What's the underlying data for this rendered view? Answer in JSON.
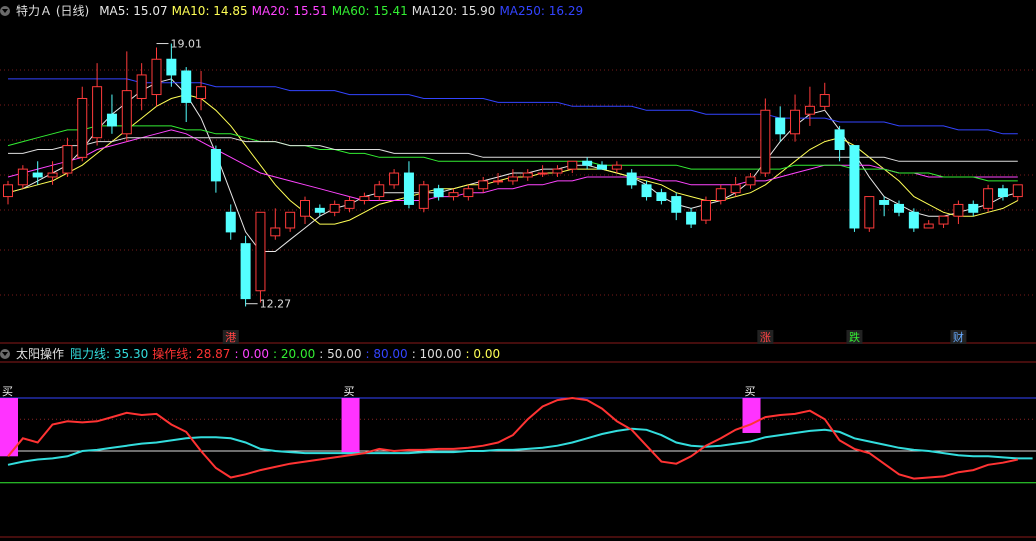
{
  "main_header": {
    "title": "特力Ａ (日线)",
    "ma": [
      {
        "label": "MA5: 15.07",
        "color": "#e8e8e8"
      },
      {
        "label": "MA10: 14.85",
        "color": "#ffff55"
      },
      {
        "label": "MA20: 15.51",
        "color": "#ff44ff"
      },
      {
        "label": "MA60: 15.41",
        "color": "#33ee33"
      },
      {
        "label": "MA120: 15.90",
        "color": "#dddddd"
      },
      {
        "label": "MA250: 16.29",
        "color": "#3344ff"
      }
    ]
  },
  "sub_header": {
    "title": "太阳操作",
    "items": [
      {
        "label": "阻力线: 35.30",
        "color": "#33dddd"
      },
      {
        "label": "操作线: 28.87",
        "color": "#ff3333"
      },
      {
        "label": ": 0.00",
        "color": "#ff44ff"
      },
      {
        "label": ": 20.00",
        "color": "#33ee33"
      },
      {
        "label": ": 50.00",
        "color": "#dddddd"
      },
      {
        "label": ": 80.00",
        "color": "#3344ff"
      },
      {
        "label": ": 100.00",
        "color": "#dddddd"
      },
      {
        "label": ": 0.00",
        "color": "#ffff55"
      }
    ]
  },
  "chart_data": [
    {
      "type": "candlestick",
      "title": "特力Ａ (日线)",
      "ylim": [
        11.6,
        19.5
      ],
      "price_labels": {
        "high": "19.01",
        "low": "12.27"
      },
      "event_markers": [
        {
          "label": "港",
          "index": 15,
          "color": "#ff4444"
        },
        {
          "label": "涨",
          "index": 51,
          "color": "#ff4444"
        },
        {
          "label": "跌",
          "index": 57,
          "color": "#33ee33"
        },
        {
          "label": "财",
          "index": 64,
          "color": "#66aaff"
        }
      ],
      "candles": [
        [
          15.0,
          15.3,
          14.8,
          15.4
        ],
        [
          15.3,
          15.7,
          15.2,
          15.8
        ],
        [
          15.6,
          15.5,
          15.3,
          15.9
        ],
        [
          15.5,
          15.6,
          15.3,
          15.9
        ],
        [
          15.6,
          16.3,
          15.5,
          16.5
        ],
        [
          16.0,
          17.5,
          15.9,
          17.8
        ],
        [
          16.5,
          17.8,
          16.3,
          18.4
        ],
        [
          17.1,
          16.8,
          16.6,
          17.6
        ],
        [
          16.6,
          17.7,
          16.4,
          18.7
        ],
        [
          17.5,
          18.1,
          17.2,
          18.4
        ],
        [
          17.6,
          18.5,
          17.3,
          18.8
        ],
        [
          18.5,
          18.1,
          17.8,
          18.9
        ],
        [
          18.2,
          17.4,
          16.9,
          18.3
        ],
        [
          17.5,
          17.8,
          17.2,
          18.2
        ],
        [
          16.2,
          15.4,
          15.1,
          16.3
        ],
        [
          14.6,
          14.1,
          13.9,
          14.8
        ],
        [
          13.8,
          12.4,
          12.2,
          14.0
        ],
        [
          12.6,
          14.6,
          12.3,
          14.6
        ],
        [
          14.0,
          14.2,
          13.9,
          14.7
        ],
        [
          14.2,
          14.6,
          14.1,
          14.6
        ],
        [
          14.5,
          14.9,
          14.3,
          15.0
        ],
        [
          14.7,
          14.6,
          14.5,
          14.8
        ],
        [
          14.6,
          14.8,
          14.5,
          14.9
        ],
        [
          14.7,
          14.9,
          14.6,
          15.0
        ],
        [
          14.9,
          15.0,
          14.8,
          15.1
        ],
        [
          15.0,
          15.3,
          14.9,
          15.4
        ],
        [
          15.3,
          15.6,
          15.2,
          15.7
        ],
        [
          15.6,
          14.8,
          14.7,
          15.9
        ],
        [
          14.7,
          15.3,
          14.6,
          15.4
        ],
        [
          15.2,
          15.0,
          14.9,
          15.3
        ],
        [
          15.0,
          15.1,
          14.9,
          15.2
        ],
        [
          15.0,
          15.2,
          14.9,
          15.3
        ],
        [
          15.2,
          15.4,
          15.1,
          15.5
        ],
        [
          15.4,
          15.4,
          15.3,
          15.6
        ],
        [
          15.4,
          15.5,
          15.3,
          15.7
        ],
        [
          15.5,
          15.6,
          15.4,
          15.7
        ],
        [
          15.6,
          15.6,
          15.5,
          15.8
        ],
        [
          15.6,
          15.7,
          15.5,
          15.8
        ],
        [
          15.7,
          15.9,
          15.6,
          15.9
        ],
        [
          15.9,
          15.8,
          15.7,
          16.0
        ],
        [
          15.8,
          15.7,
          15.7,
          15.9
        ],
        [
          15.7,
          15.8,
          15.6,
          15.9
        ],
        [
          15.6,
          15.3,
          15.2,
          15.7
        ],
        [
          15.3,
          15.0,
          14.9,
          15.4
        ],
        [
          15.1,
          14.9,
          14.8,
          15.2
        ],
        [
          15.0,
          14.6,
          14.4,
          15.1
        ],
        [
          14.6,
          14.3,
          14.2,
          14.7
        ],
        [
          14.4,
          14.9,
          14.3,
          15.0
        ],
        [
          14.9,
          15.2,
          14.8,
          15.3
        ],
        [
          15.1,
          15.3,
          15.0,
          15.5
        ],
        [
          15.3,
          15.5,
          15.2,
          15.6
        ],
        [
          15.6,
          17.2,
          15.5,
          17.5
        ],
        [
          17.0,
          16.6,
          16.4,
          17.3
        ],
        [
          16.6,
          17.2,
          16.4,
          17.6
        ],
        [
          17.1,
          17.3,
          16.8,
          17.8
        ],
        [
          17.3,
          17.6,
          17.2,
          17.9
        ],
        [
          16.7,
          16.2,
          15.9,
          16.8
        ],
        [
          16.3,
          14.2,
          14.1,
          16.3
        ],
        [
          14.2,
          15.0,
          14.1,
          15.0
        ],
        [
          14.9,
          14.8,
          14.5,
          15.0
        ],
        [
          14.8,
          14.6,
          14.5,
          14.9
        ],
        [
          14.6,
          14.2,
          14.1,
          14.7
        ],
        [
          14.2,
          14.3,
          14.2,
          14.4
        ],
        [
          14.3,
          14.5,
          14.2,
          14.5
        ],
        [
          14.5,
          14.8,
          14.3,
          14.9
        ],
        [
          14.8,
          14.6,
          14.5,
          14.9
        ],
        [
          14.7,
          15.2,
          14.6,
          15.3
        ],
        [
          15.2,
          15.0,
          14.9,
          15.3
        ],
        [
          15.0,
          15.3,
          14.9,
          15.3
        ]
      ],
      "series": [
        {
          "name": "MA5",
          "color": "#e8e8e8",
          "values": [
            15.1,
            15.2,
            15.4,
            15.6,
            15.8,
            16.2,
            16.7,
            17.1,
            17.4,
            17.7,
            17.9,
            18.0,
            17.6,
            17.0,
            16.1,
            15.1,
            14.1,
            13.6,
            13.6,
            13.9,
            14.2,
            14.5,
            14.7,
            14.8,
            15.0,
            15.1,
            15.1,
            15.1,
            15.1,
            15.1,
            15.2,
            15.3,
            15.4,
            15.5,
            15.6,
            15.6,
            15.7,
            15.7,
            15.8,
            15.8,
            15.7,
            15.6,
            15.5,
            15.3,
            15.0,
            14.8,
            14.7,
            14.8,
            14.9,
            15.1,
            15.4,
            15.9,
            16.4,
            16.8,
            17.1,
            17.2,
            16.7,
            16.1,
            15.5,
            15.0,
            14.8,
            14.6,
            14.5,
            14.5,
            14.6,
            14.7,
            14.8,
            15.0,
            15.1
          ]
        },
        {
          "name": "MA10",
          "color": "#ffff55",
          "values": [
            15.1,
            15.2,
            15.3,
            15.4,
            15.6,
            15.8,
            16.1,
            16.4,
            16.7,
            17.0,
            17.3,
            17.5,
            17.6,
            17.5,
            17.2,
            16.8,
            16.3,
            15.8,
            15.3,
            14.9,
            14.6,
            14.3,
            14.3,
            14.4,
            14.6,
            14.8,
            14.9,
            15.0,
            15.1,
            15.2,
            15.2,
            15.3,
            15.3,
            15.4,
            15.5,
            15.5,
            15.6,
            15.6,
            15.7,
            15.7,
            15.7,
            15.6,
            15.5,
            15.4,
            15.3,
            15.1,
            15.0,
            14.9,
            14.9,
            15.0,
            15.1,
            15.3,
            15.6,
            15.9,
            16.2,
            16.4,
            16.5,
            16.3,
            16.0,
            15.7,
            15.4,
            15.0,
            14.8,
            14.6,
            14.5,
            14.5,
            14.6,
            14.7,
            14.9
          ]
        },
        {
          "name": "MA20",
          "color": "#ff44ff",
          "values": [
            15.5,
            15.6,
            15.7,
            15.8,
            15.9,
            16.0,
            16.2,
            16.3,
            16.4,
            16.5,
            16.6,
            16.7,
            16.6,
            16.4,
            16.2,
            16.0,
            15.8,
            15.6,
            15.5,
            15.4,
            15.3,
            15.2,
            15.1,
            15.0,
            14.9,
            14.9,
            14.9,
            14.9,
            14.9,
            15.0,
            15.0,
            15.1,
            15.1,
            15.2,
            15.2,
            15.3,
            15.3,
            15.4,
            15.4,
            15.5,
            15.5,
            15.5,
            15.5,
            15.5,
            15.4,
            15.4,
            15.3,
            15.3,
            15.3,
            15.3,
            15.4,
            15.4,
            15.5,
            15.6,
            15.7,
            15.8,
            15.8,
            15.8,
            15.8,
            15.7,
            15.6,
            15.6,
            15.5,
            15.5,
            15.5,
            15.5,
            15.5,
            15.5,
            15.5
          ]
        },
        {
          "name": "MA60",
          "color": "#33ee33",
          "values": [
            16.3,
            16.4,
            16.5,
            16.6,
            16.7,
            16.7,
            16.8,
            16.8,
            16.8,
            16.8,
            16.8,
            16.8,
            16.7,
            16.7,
            16.6,
            16.6,
            16.5,
            16.4,
            16.4,
            16.3,
            16.3,
            16.2,
            16.2,
            16.1,
            16.1,
            16.0,
            16.0,
            16.0,
            16.0,
            15.9,
            15.9,
            15.9,
            15.9,
            15.9,
            15.9,
            15.9,
            15.9,
            15.9,
            15.9,
            15.9,
            15.8,
            15.8,
            15.8,
            15.8,
            15.8,
            15.8,
            15.7,
            15.7,
            15.7,
            15.7,
            15.7,
            15.7,
            15.7,
            15.8,
            15.8,
            15.8,
            15.8,
            15.7,
            15.7,
            15.7,
            15.6,
            15.6,
            15.6,
            15.5,
            15.5,
            15.5,
            15.4,
            15.4,
            15.4
          ]
        },
        {
          "name": "MA120",
          "color": "#dddddd",
          "values": [
            16.1,
            16.1,
            16.2,
            16.2,
            16.3,
            16.3,
            16.4,
            16.4,
            16.5,
            16.5,
            16.5,
            16.5,
            16.5,
            16.5,
            16.5,
            16.5,
            16.4,
            16.4,
            16.4,
            16.3,
            16.3,
            16.3,
            16.2,
            16.2,
            16.2,
            16.2,
            16.1,
            16.1,
            16.1,
            16.1,
            16.1,
            16.1,
            16.0,
            16.0,
            16.0,
            16.0,
            16.0,
            16.0,
            16.0,
            16.0,
            16.0,
            16.0,
            16.0,
            16.0,
            16.0,
            16.0,
            16.0,
            16.0,
            16.0,
            16.0,
            16.0,
            16.0,
            16.0,
            16.0,
            16.0,
            16.0,
            16.0,
            16.0,
            16.0,
            16.0,
            15.9,
            15.9,
            15.9,
            15.9,
            15.9,
            15.9,
            15.9,
            15.9,
            15.9
          ]
        },
        {
          "name": "MA250",
          "color": "#3344ff",
          "values": [
            18.0,
            18.0,
            18.0,
            18.0,
            18.0,
            18.0,
            18.0,
            18.0,
            18.0,
            17.9,
            17.9,
            17.9,
            17.9,
            17.9,
            17.8,
            17.8,
            17.8,
            17.8,
            17.8,
            17.7,
            17.7,
            17.7,
            17.7,
            17.6,
            17.6,
            17.6,
            17.6,
            17.6,
            17.5,
            17.5,
            17.5,
            17.5,
            17.5,
            17.4,
            17.4,
            17.4,
            17.4,
            17.4,
            17.3,
            17.3,
            17.3,
            17.3,
            17.3,
            17.2,
            17.2,
            17.2,
            17.2,
            17.1,
            17.1,
            17.1,
            17.1,
            17.1,
            17.0,
            17.0,
            17.0,
            17.0,
            16.9,
            16.9,
            16.9,
            16.9,
            16.8,
            16.8,
            16.8,
            16.8,
            16.7,
            16.7,
            16.7,
            16.6,
            16.6
          ]
        }
      ]
    },
    {
      "type": "line",
      "title": "太阳操作",
      "ylim": [
        -5,
        112
      ],
      "hlines": [
        {
          "value": 100,
          "color": "#3344ff"
        },
        {
          "value": 50,
          "color": "#dddddd"
        },
        {
          "value": 20,
          "color": "#33ee33"
        },
        {
          "value": 80,
          "color": "#8a2222"
        }
      ],
      "buy_markers": [
        {
          "label": "买",
          "index": 0,
          "top": 100,
          "bottom": 45,
          "color": "#ff33ff"
        },
        {
          "label": "买",
          "index": 23,
          "top": 100,
          "bottom": 47,
          "color": "#ff33ff"
        },
        {
          "label": "买",
          "index": 50,
          "top": 100,
          "bottom": 67,
          "color": "#ff33ff"
        }
      ],
      "series": [
        {
          "name": "阻力线",
          "color": "#33dddd",
          "values": [
            37,
            40,
            42,
            43,
            45,
            50,
            51,
            53,
            55,
            57,
            58,
            60,
            62,
            63,
            63,
            62,
            58,
            52,
            50,
            49,
            48,
            48,
            48,
            48,
            48,
            48,
            48,
            48,
            49,
            49,
            49,
            50,
            50,
            51,
            51,
            52,
            53,
            55,
            58,
            62,
            66,
            69,
            71,
            70,
            65,
            58,
            55,
            54,
            55,
            57,
            59,
            63,
            65,
            67,
            69,
            70,
            68,
            62,
            59,
            56,
            53,
            51,
            50,
            48,
            46,
            45,
            45,
            44,
            43,
            43
          ]
        },
        {
          "name": "操作线",
          "color": "#ff3333",
          "values": [
            45,
            62,
            58,
            75,
            78,
            77,
            78,
            82,
            86,
            84,
            85,
            75,
            68,
            50,
            34,
            25,
            28,
            32,
            35,
            38,
            40,
            42,
            44,
            46,
            48,
            52,
            50,
            51,
            51,
            52,
            52,
            53,
            55,
            58,
            65,
            80,
            92,
            98,
            100,
            98,
            90,
            78,
            70,
            55,
            40,
            38,
            45,
            55,
            62,
            70,
            75,
            82,
            84,
            85,
            88,
            80,
            60,
            52,
            48,
            38,
            28,
            24,
            25,
            26,
            30,
            32,
            37,
            39,
            42
          ]
        }
      ]
    }
  ]
}
